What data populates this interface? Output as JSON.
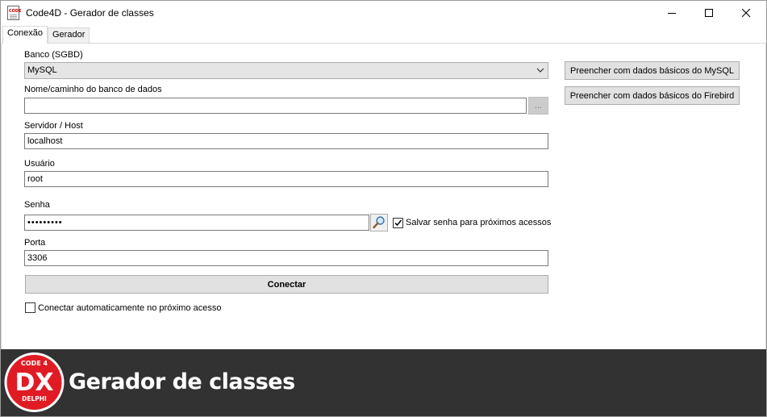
{
  "window": {
    "title": "Code4D - Gerador de classes",
    "icon_label": "CODE"
  },
  "tabs": [
    {
      "label": "Conexão",
      "active": true
    },
    {
      "label": "Gerador",
      "active": false
    }
  ],
  "form": {
    "banco_label": "Banco (SGBD)",
    "banco_value": "MySQL",
    "nome_label": "Nome/caminho do banco de dados",
    "nome_value": "",
    "browse_label": "...",
    "servidor_label": "Servidor / Host",
    "servidor_value": "localhost",
    "usuario_label": "Usuário",
    "usuario_value": "root",
    "senha_label": "Senha",
    "senha_value": "•••••••••",
    "salvar_senha_label": "Salvar senha para próximos acessos",
    "salvar_senha_checked": true,
    "porta_label": "Porta",
    "porta_value": "3306",
    "conectar_label": "Conectar",
    "auto_label": "Conectar automaticamente no próximo acesso",
    "auto_checked": false
  },
  "side_buttons": {
    "mysql_label": "Preencher com dados básicos do MySQL",
    "firebird_label": "Preencher com dados básicos do Firebird"
  },
  "footer": {
    "logo_top": "CODE 4",
    "logo_main": "DX",
    "logo_bottom": "DELPHI",
    "title": "Gerador de classes"
  },
  "colors": {
    "footer_bg": "#323232",
    "logo_red": "#e01b24"
  }
}
